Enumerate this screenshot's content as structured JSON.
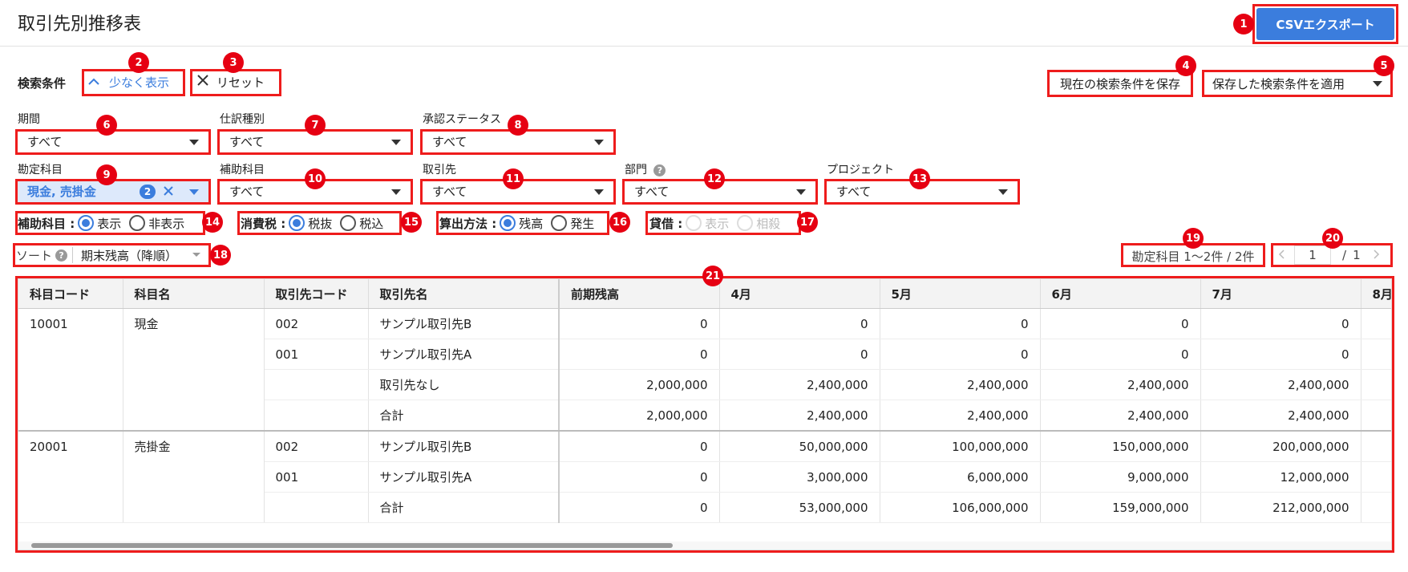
{
  "header": {
    "title": "取引先別推移表",
    "export_label": "CSVエクスポート"
  },
  "search": {
    "section_label": "検索条件",
    "show_less_label": "少なく表示",
    "reset_label": "リセット",
    "save_label": "現在の検索条件を保存",
    "apply_saved_label": "保存した検索条件を適用"
  },
  "filters": {
    "period": {
      "label": "期間",
      "value": "すべて"
    },
    "journal_type": {
      "label": "仕訳種別",
      "value": "すべて"
    },
    "approval_status": {
      "label": "承認ステータス",
      "value": "すべて"
    },
    "account": {
      "label": "勘定科目",
      "value": "現金, 売掛金",
      "count": "2"
    },
    "sub_account": {
      "label": "補助科目",
      "value": "すべて"
    },
    "partner": {
      "label": "取引先",
      "value": "すべて"
    },
    "department": {
      "label": "部門",
      "value": "すべて"
    },
    "project": {
      "label": "プロジェクト",
      "value": "すべて"
    }
  },
  "options": {
    "sub_account": {
      "label": "補助科目 :",
      "opt1": "表示",
      "opt2": "非表示"
    },
    "tax": {
      "label": "消費税 :",
      "opt1": "税抜",
      "opt2": "税込"
    },
    "calc": {
      "label": "算出方法 :",
      "opt1": "残高",
      "opt2": "発生"
    },
    "debit_credit": {
      "label": "貸借 :",
      "opt1": "表示",
      "opt2": "相殺"
    }
  },
  "sort": {
    "label": "ソート",
    "value": "期末残高（降順）"
  },
  "pagination": {
    "count_text": "勘定科目 1〜2件 / 2件",
    "current": "1",
    "separator": "/",
    "total": "1"
  },
  "table": {
    "headers": [
      "科目コード",
      "科目名",
      "取引先コード",
      "取引先名",
      "前期残高",
      "4月",
      "5月",
      "6月",
      "7月",
      "8月"
    ],
    "rows": [
      [
        "10001",
        "現金",
        "002",
        "サンプル取引先B",
        "0",
        "0",
        "0",
        "0",
        "0",
        ""
      ],
      [
        "",
        "",
        "001",
        "サンプル取引先A",
        "0",
        "0",
        "0",
        "0",
        "0",
        ""
      ],
      [
        "",
        "",
        "",
        "取引先なし",
        "2,000,000",
        "2,400,000",
        "2,400,000",
        "2,400,000",
        "2,400,000",
        ""
      ],
      [
        "",
        "",
        "",
        "合計",
        "2,000,000",
        "2,400,000",
        "2,400,000",
        "2,400,000",
        "2,400,000",
        ""
      ],
      [
        "20001",
        "売掛金",
        "002",
        "サンプル取引先B",
        "0",
        "50,000,000",
        "100,000,000",
        "150,000,000",
        "200,000,000",
        ""
      ],
      [
        "",
        "",
        "001",
        "サンプル取引先A",
        "0",
        "3,000,000",
        "6,000,000",
        "9,000,000",
        "12,000,000",
        ""
      ],
      [
        "",
        "",
        "",
        "合計",
        "0",
        "53,000,000",
        "106,000,000",
        "159,000,000",
        "212,000,000",
        ""
      ]
    ]
  },
  "badges": [
    "1",
    "2",
    "3",
    "4",
    "5",
    "6",
    "7",
    "8",
    "9",
    "10",
    "11",
    "12",
    "13",
    "14",
    "15",
    "16",
    "17",
    "18",
    "19",
    "20",
    "21"
  ],
  "colors": {
    "accent": "#3b7ddd",
    "highlight": "#ee1c1c",
    "badge": "#e60012"
  }
}
